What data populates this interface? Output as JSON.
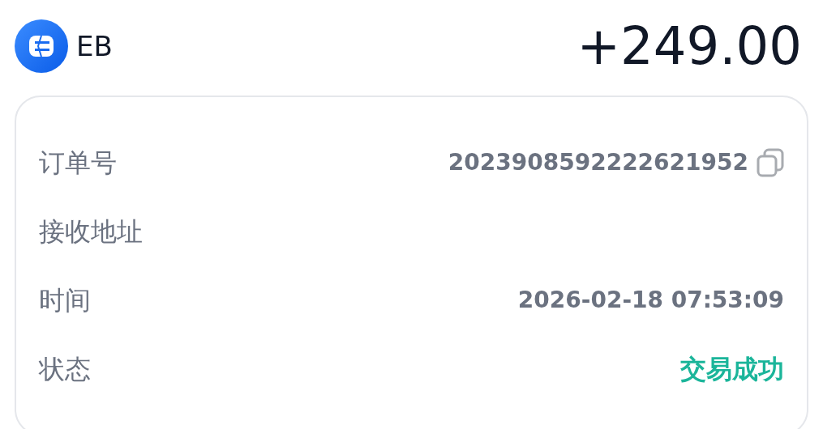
{
  "header": {
    "name": "EB",
    "amount": "+249.00"
  },
  "details": [
    {
      "kind": "copyable",
      "label": "订单号",
      "value": "2023908592222621952"
    },
    {
      "kind": "empty",
      "label": "接收地址"
    },
    {
      "kind": "text",
      "label": "时间",
      "value": "2026-02-18 07:53:09"
    },
    {
      "kind": "status",
      "label": "状态",
      "value": "交易成功",
      "color": "#1bb59a"
    }
  ]
}
